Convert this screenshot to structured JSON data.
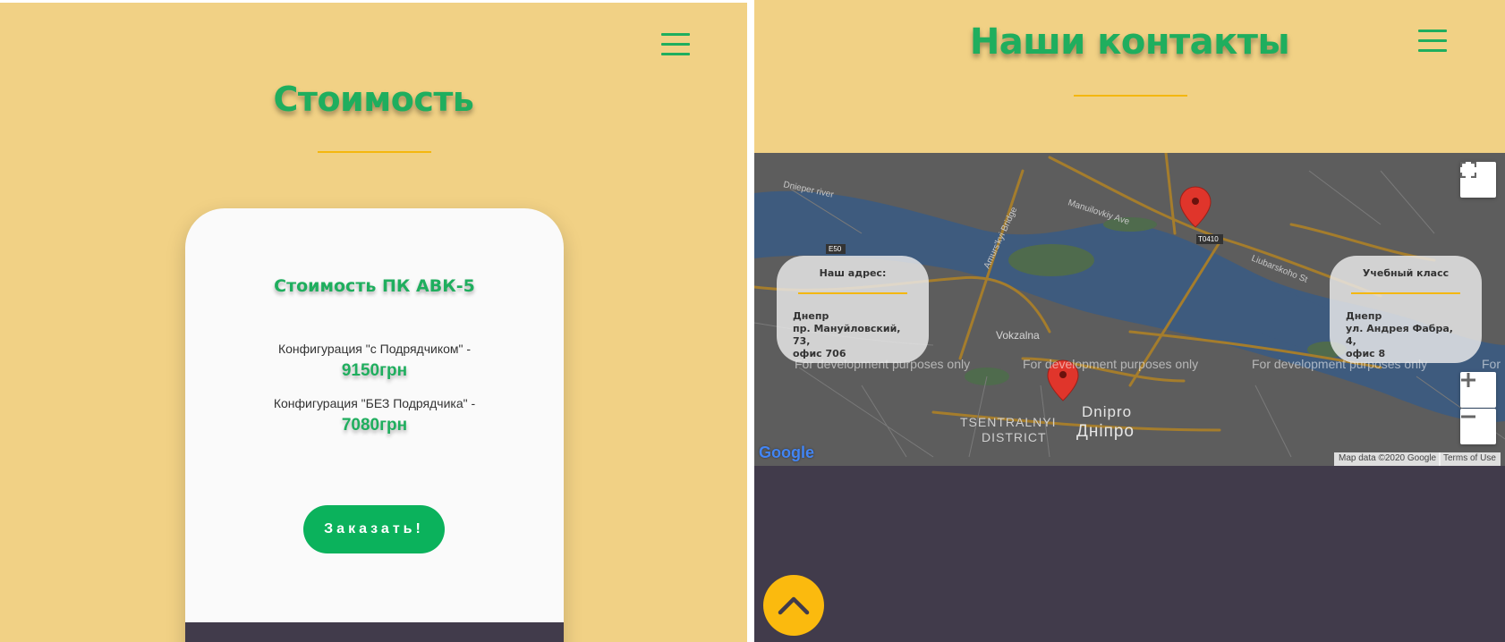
{
  "left": {
    "title": "Стоимость",
    "card": {
      "title": "Стоимость ПК АВК-5",
      "config1_label": "Конфигурация \"с Подрядчиком\" -",
      "config1_price": "9150грн",
      "config2_label": "Конфигурация \"БЕЗ Подрядчика\" -",
      "config2_price": "7080грн",
      "order_button": "Заказать!"
    }
  },
  "right": {
    "title": "Наши контакты",
    "address_card": {
      "title": "Наш адрес:",
      "city": "Днепр",
      "street": "пр. Мануйловский, 73,",
      "office": "офис 706"
    },
    "class_card": {
      "title": "Учебный класс",
      "city": "Днепр",
      "street": "ул. Андрея Фабра, 4,",
      "office": "офис 8"
    },
    "map": {
      "dev_notice": "For development purposes only",
      "dev_notice_partial": "For",
      "attribution": "Map data ©2020 Google",
      "terms": "Terms of Use",
      "logo": "Google",
      "labels": {
        "river": "Dnieper river",
        "manuilovkiy": "Manuilovkiy Ave",
        "lubarskoho": "Liubarskoho St",
        "amurs": "Amurs'kyi Bridge",
        "vokzalna": "Vokzalna",
        "dnipro": "Dnipro",
        "dnipro_ua": "Дніпро",
        "tsentralnyi": "TSENTRALNYI",
        "district": "DISTRICT",
        "e50": "E50",
        "t0410": "T0410"
      }
    }
  },
  "colors": {
    "background": "#f1d185",
    "accent_green": "#1fae5e",
    "underline_yellow": "#f4b70f",
    "dark": "#413b4b",
    "button_green": "#0bb25c",
    "scroll_button": "#fbba0e"
  },
  "icons": [
    "menu-icon",
    "fullscreen-icon",
    "zoom-in-icon",
    "zoom-out-icon",
    "map-marker-icon",
    "chevron-up-icon"
  ]
}
